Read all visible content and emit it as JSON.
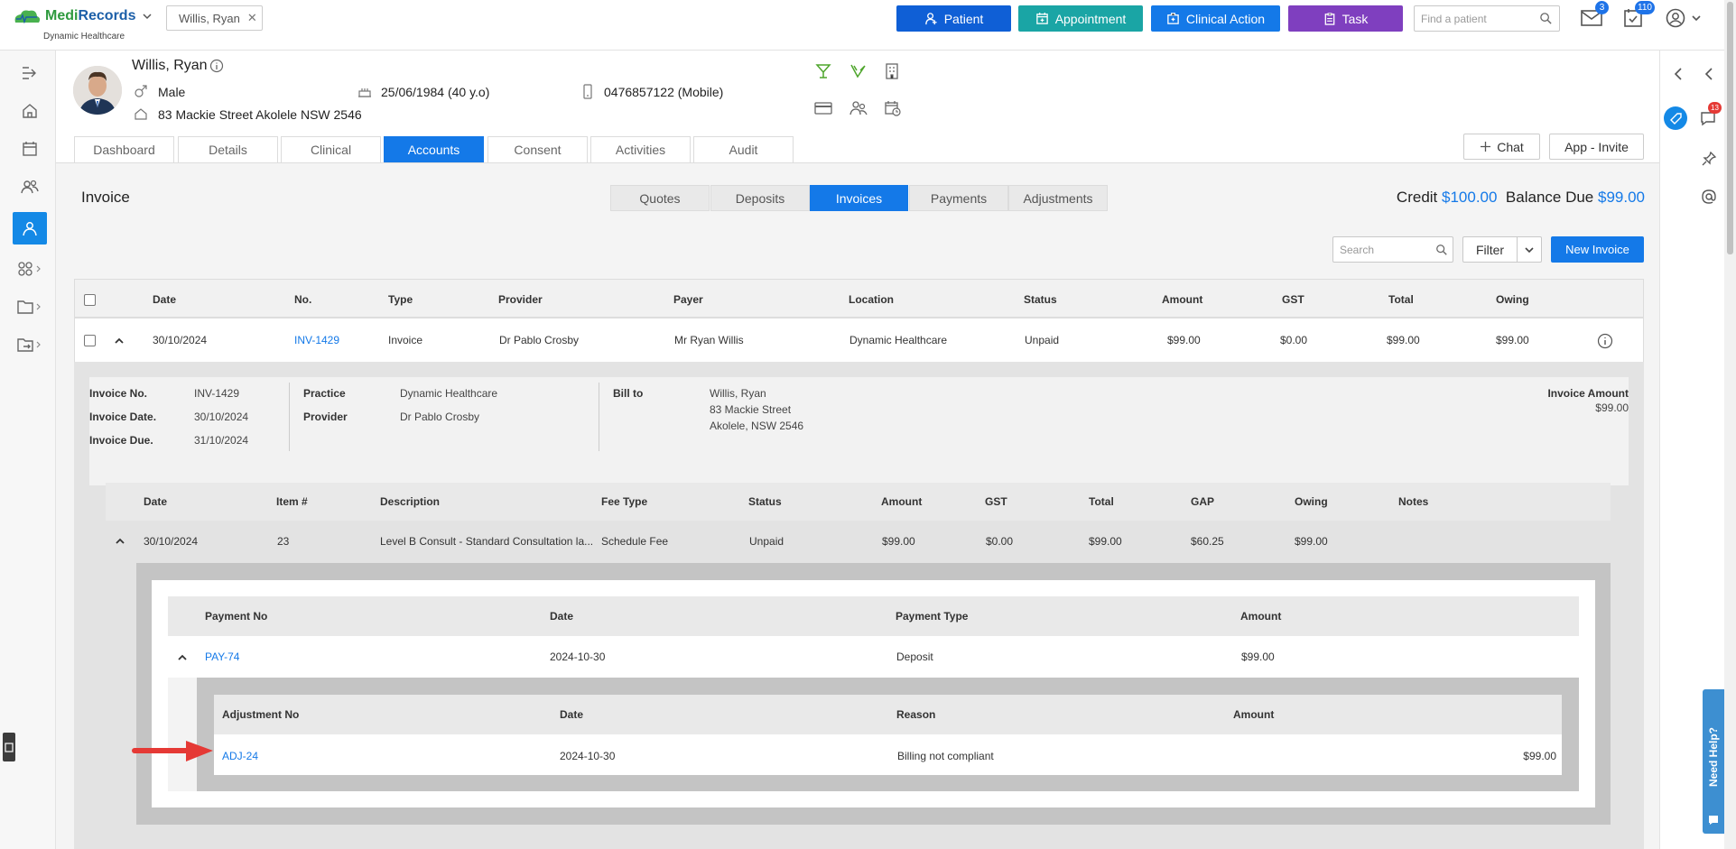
{
  "brand": {
    "medi": "Medi",
    "records": "Records",
    "sub": "Dynamic Healthcare"
  },
  "patient_tab": {
    "label": "Willis, Ryan"
  },
  "top_actions": [
    {
      "label": "Patient",
      "color": "#0f5fd6"
    },
    {
      "label": "Appointment",
      "color": "#1aa5a5"
    },
    {
      "label": "Clinical Action",
      "color": "#1479e8"
    },
    {
      "label": "Task",
      "color": "#7f3fbf"
    }
  ],
  "search": {
    "placeholder": "Find a patient"
  },
  "badges": {
    "mail": "3",
    "tasks": "110",
    "chat": "13"
  },
  "patient": {
    "name": "Willis, Ryan",
    "gender": "Male",
    "dob": "25/06/1984 (40 y.o)",
    "phone": "0476857122 (Mobile)",
    "address": "83 Mackie Street Akolele NSW 2546"
  },
  "tabs": [
    "Dashboard",
    "Details",
    "Clinical",
    "Accounts",
    "Consent",
    "Activities",
    "Audit"
  ],
  "header_buttons": {
    "chat": "Chat",
    "app_invite": "App - Invite"
  },
  "section": {
    "title": "Invoice"
  },
  "subtabs": [
    "Quotes",
    "Deposits",
    "Invoices",
    "Payments",
    "Adjustments"
  ],
  "summary": {
    "credit_label": "Credit",
    "credit_value": "$100.00",
    "balance_label": "Balance Due",
    "balance_value": "$99.00"
  },
  "toolbar": {
    "search_placeholder": "Search",
    "filter": "Filter",
    "new_invoice": "New Invoice"
  },
  "invoice_table": {
    "headers": [
      "Date",
      "No.",
      "Type",
      "Provider",
      "Payer",
      "Location",
      "Status",
      "Amount",
      "GST",
      "Total",
      "Owing"
    ],
    "row": {
      "date": "30/10/2024",
      "no": "INV-1429",
      "type": "Invoice",
      "provider": "Dr Pablo Crosby",
      "payer": "Mr Ryan Willis",
      "location": "Dynamic Healthcare",
      "status": "Unpaid",
      "amount": "$99.00",
      "gst": "$0.00",
      "total": "$99.00",
      "owing": "$99.00"
    }
  },
  "invoice_detail": {
    "invoice_no_label": "Invoice No.",
    "invoice_no": "INV-1429",
    "invoice_date_label": "Invoice Date.",
    "invoice_date": "30/10/2024",
    "invoice_due_label": "Invoice Due.",
    "invoice_due": "31/10/2024",
    "practice_label": "Practice",
    "practice": "Dynamic Healthcare",
    "provider_label": "Provider",
    "provider": "Dr Pablo Crosby",
    "bill_to_label": "Bill to",
    "bill_to": [
      "Willis, Ryan",
      "83 Mackie Street",
      "Akolele, NSW 2546"
    ],
    "invoice_amount_label": "Invoice Amount",
    "invoice_amount": "$99.00"
  },
  "items_table": {
    "headers": [
      "Date",
      "Item #",
      "Description",
      "Fee Type",
      "Status",
      "Amount",
      "GST",
      "Total",
      "GAP",
      "Owing",
      "Notes"
    ],
    "row": {
      "date": "30/10/2024",
      "item": "23",
      "description": "Level B Consult - Standard Consultation la...",
      "fee_type": "Schedule Fee",
      "status": "Unpaid",
      "amount": "$99.00",
      "gst": "$0.00",
      "total": "$99.00",
      "gap": "$60.25",
      "owing": "$99.00"
    }
  },
  "payments_table": {
    "headers": [
      "Payment No",
      "Date",
      "Payment Type",
      "Amount"
    ],
    "row": {
      "no": "PAY-74",
      "date": "2024-10-30",
      "type": "Deposit",
      "amount": "$99.00"
    }
  },
  "adjustments_table": {
    "headers": [
      "Adjustment No",
      "Date",
      "Reason",
      "Amount"
    ],
    "row": {
      "no": "ADJ-24",
      "date": "2024-10-30",
      "reason": "Billing not compliant",
      "amount": "$99.00"
    }
  },
  "help": {
    "label": "Need Help?"
  }
}
